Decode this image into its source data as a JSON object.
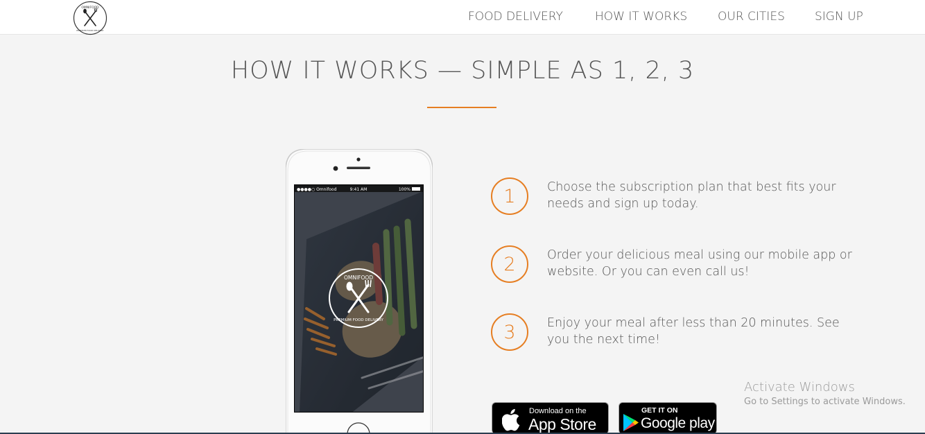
{
  "nav": {
    "logo_text_top": "OMNIFOOD",
    "logo_text_bottom": "PREMIUM FOOD DELIVERY",
    "links": [
      "FOOD DELIVERY",
      "HOW IT WORKS",
      "OUR CITIES",
      "SIGN UP"
    ]
  },
  "section": {
    "title": "HOW IT WORKS — SIMPLE AS 1, 2, 3"
  },
  "phone": {
    "carrier": "●●●●○ Omnifood",
    "time": "9:41 AM",
    "battery": "100%",
    "logo_top": "OMNIFOOD",
    "logo_bottom": "PREMIUM FOOD DELIVERY"
  },
  "steps": [
    {
      "num": "1",
      "text": "Choose the subscription plan that best fits your needs and sign up today."
    },
    {
      "num": "2",
      "text": "Order your delicious meal using our mobile app or website. Or you can even call us!"
    },
    {
      "num": "3",
      "text": "Enjoy your meal after less than 20 minutes. See you the next time!"
    }
  ],
  "stores": {
    "apple_small": "Download on the",
    "apple_big": "App Store",
    "google_small": "GET IT ON",
    "google_big": "Google play"
  },
  "watermark": {
    "title": "Activate Windows",
    "subtitle": "Go to Settings to activate Windows."
  },
  "colors": {
    "accent": "#e67e22",
    "background": "#f4f4f4",
    "text": "#555555"
  }
}
